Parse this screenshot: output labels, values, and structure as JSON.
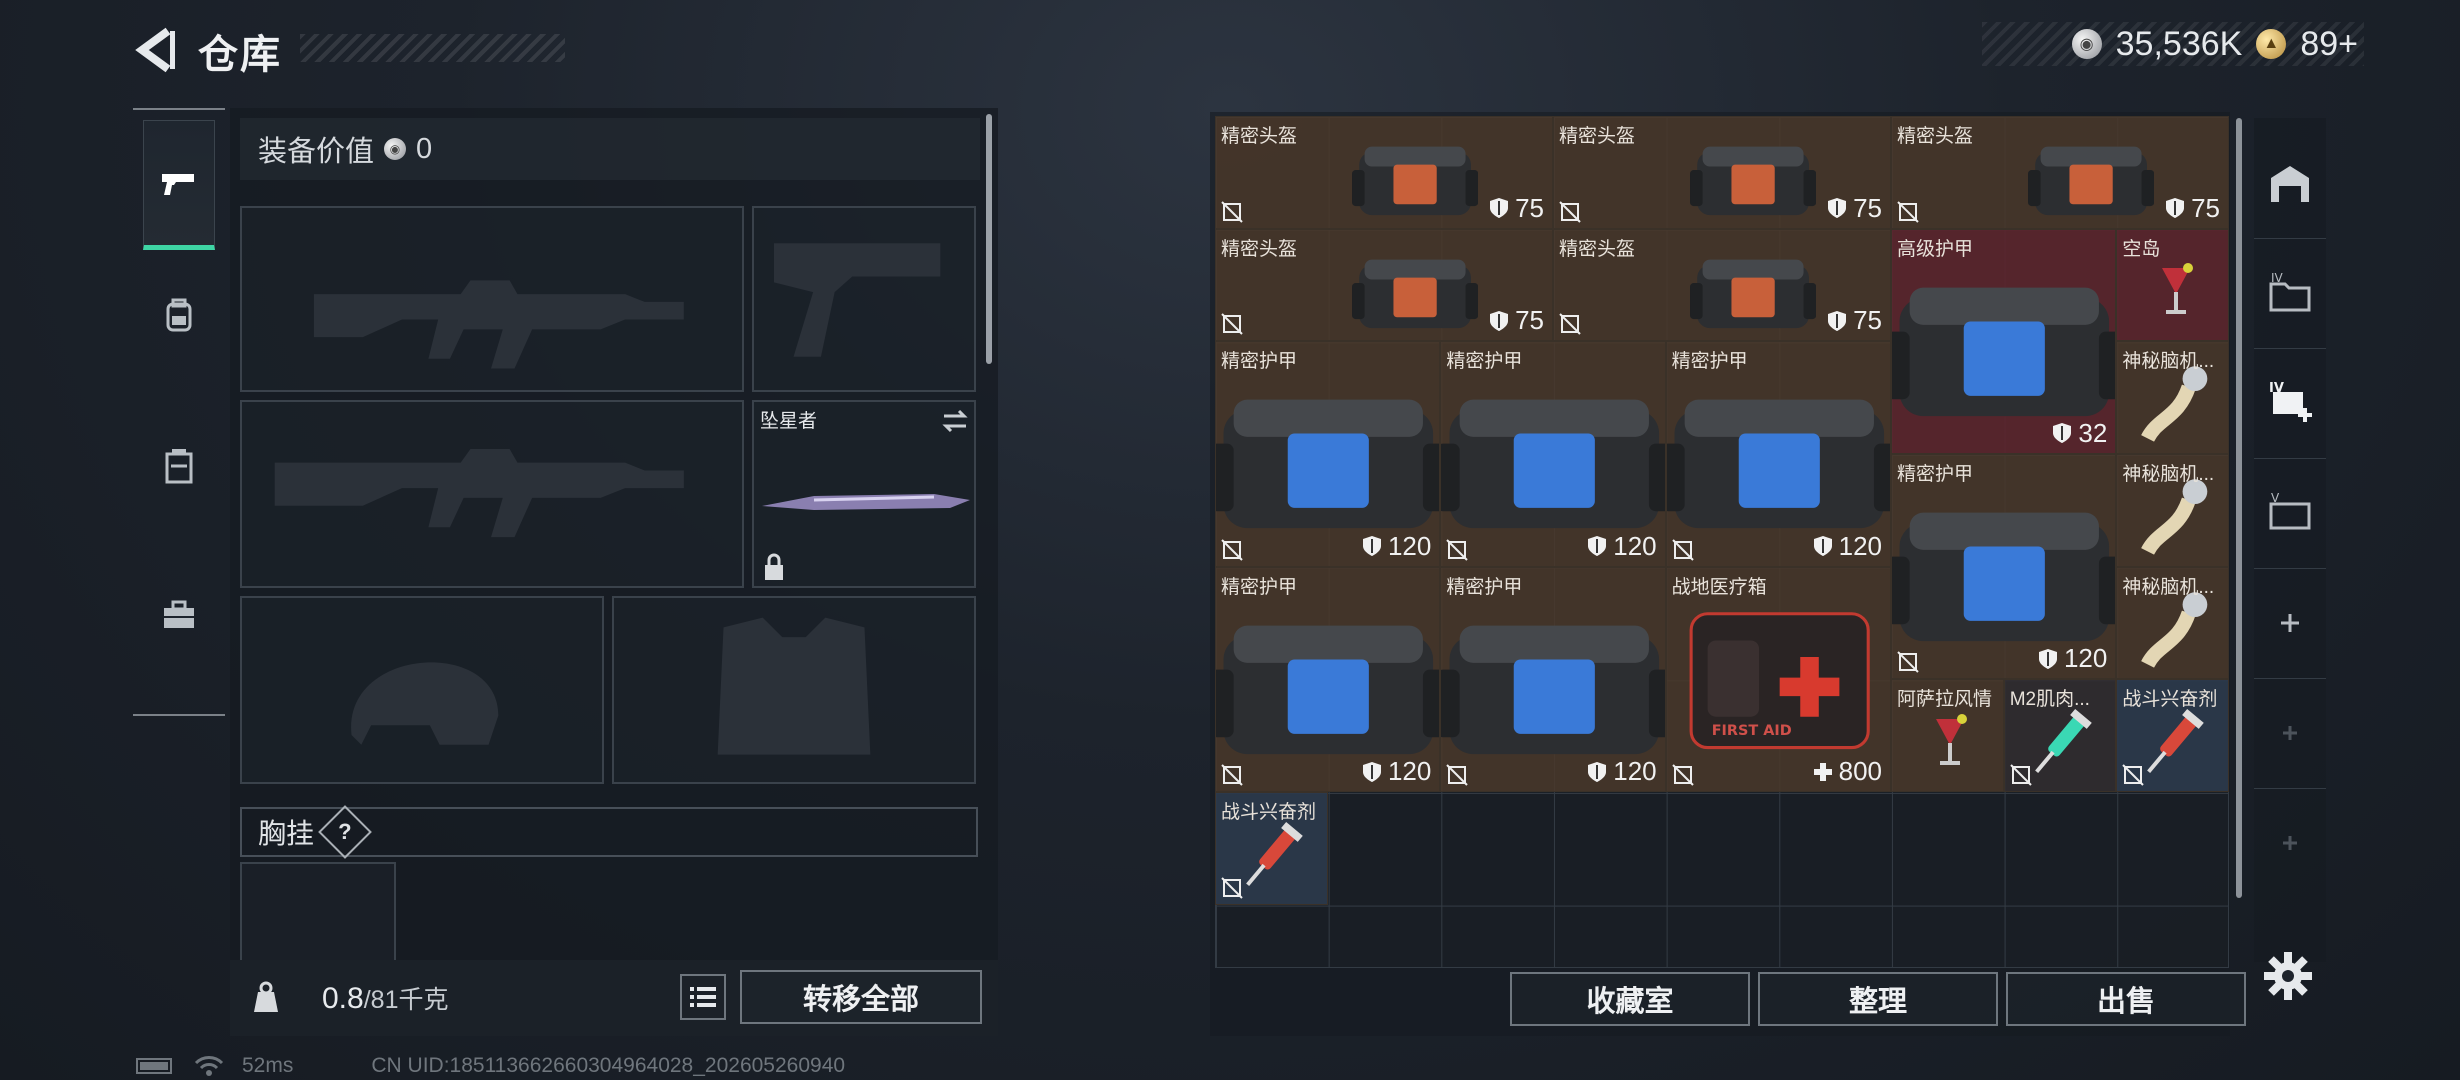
{
  "header": {
    "title": "仓库",
    "silver": "35,536K",
    "gold": "89+"
  },
  "equipment": {
    "value_label": "装备价值",
    "value": "0",
    "melee_name": "坠星者",
    "chest_label": "胸挂",
    "chest_help": "?",
    "weight_current": "0.8",
    "weight_max": "/81千克",
    "transfer_all": "转移全部"
  },
  "inventory": {
    "items": [
      {
        "name": "精密头盔",
        "durability": "75"
      },
      {
        "name": "精密头盔",
        "durability": "75"
      },
      {
        "name": "精密头盔",
        "durability": "75"
      },
      {
        "name": "精密头盔",
        "durability": "75"
      },
      {
        "name": "精密头盔",
        "durability": "75"
      },
      {
        "name": "高级护甲",
        "durability": "32"
      },
      {
        "name": "空岛"
      },
      {
        "name": "精密护甲",
        "durability": "120"
      },
      {
        "name": "精密护甲",
        "durability": "120"
      },
      {
        "name": "精密护甲",
        "durability": "120"
      },
      {
        "name": "神秘脑机..."
      },
      {
        "name": "精密护甲",
        "durability": "120"
      },
      {
        "name": "神秘脑机..."
      },
      {
        "name": "精密护甲",
        "durability": "120"
      },
      {
        "name": "精密护甲",
        "durability": "120"
      },
      {
        "name": "战地医疗箱",
        "heal": "800",
        "kit_text": "FIRST AID"
      },
      {
        "name": "神秘脑机..."
      },
      {
        "name": "阿萨拉风情"
      },
      {
        "name": "M2肌肉..."
      },
      {
        "name": "战斗兴奋剂"
      },
      {
        "name": "战斗兴奋剂"
      }
    ],
    "buttons": {
      "collection": "收藏室",
      "sort": "整理",
      "sell": "出售"
    }
  },
  "side_tabs": [
    "weapons-tab",
    "backpack-tab",
    "container-tab",
    "toolbox-tab"
  ],
  "status": {
    "ping": "52ms",
    "uid": "CN UID:1851136626603049640​28_202605260940"
  },
  "colors": {
    "accent": "#3ed5a4",
    "rare_bg": "#4a2a2a",
    "epic_bg": "#5a2a30",
    "stim_bg": "#2d3b4d"
  }
}
